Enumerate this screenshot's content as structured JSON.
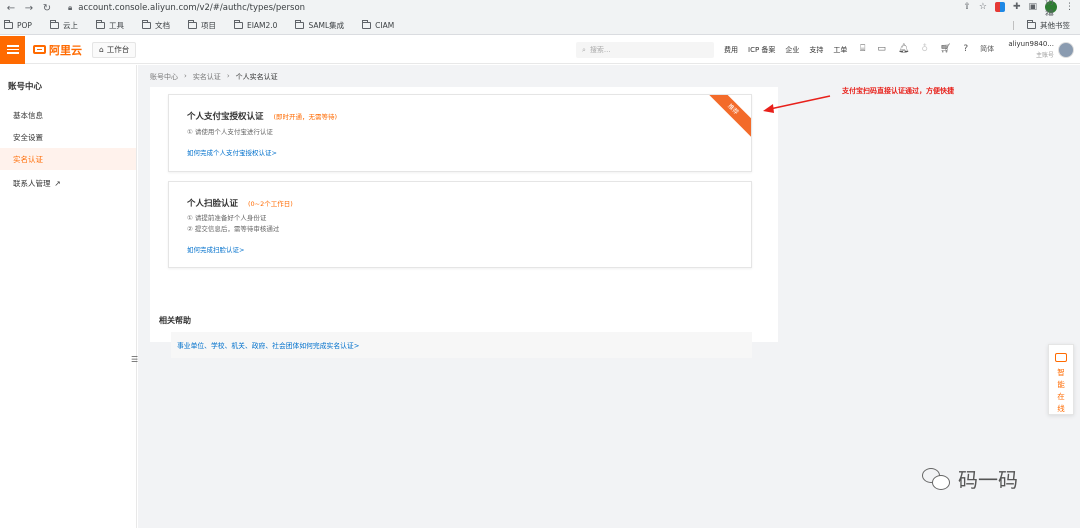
{
  "browser": {
    "url": "account.console.aliyun.com/v2/#/authc/types/person",
    "profile_badge": "仿禧",
    "bookmarks": [
      "POP",
      "云上",
      "工具",
      "文档",
      "项目",
      "EIAM2.0",
      "SAML集成",
      "CIAM"
    ],
    "other_bookmarks": "其他书签"
  },
  "header": {
    "logo_text": "阿里云",
    "workbench": "工作台",
    "search_placeholder": "搜索...",
    "menu": [
      "费用",
      "ICP 备案",
      "企业",
      "支持",
      "工单"
    ],
    "language": "简体",
    "account_name": "aliyun9840...",
    "account_role": "主账号"
  },
  "sidebar": {
    "title": "账号中心",
    "items": [
      {
        "label": "基本信息",
        "active": false
      },
      {
        "label": "安全设置",
        "active": false
      },
      {
        "label": "实名认证",
        "active": true
      },
      {
        "label": "联系人管理",
        "active": false
      }
    ]
  },
  "breadcrumb": [
    "账号中心",
    "实名认证",
    "个人实名认证"
  ],
  "cards": [
    {
      "title": "个人支付宝授权认证",
      "hint": "(即时开通，无需等待)",
      "lines": [
        "① 请使用个人支付宝进行认证"
      ],
      "link": "如何完成个人支付宝授权认证>",
      "ribbon": "推荐"
    },
    {
      "title": "个人扫脸认证",
      "hint": "(0~2个工作日)",
      "lines": [
        "① 请提前准备好个人身份证",
        "② 提交信息后，需等待审核通过"
      ],
      "link": "如何完成扫脸认证>"
    }
  ],
  "help": {
    "title": "相关帮助",
    "link": "事业单位、学校、机关、政府、社会团体如何完成实名认证>"
  },
  "annotation": "支付宝扫码直接认证通过，方便快捷",
  "float_help": [
    "智",
    "能",
    "在",
    "线"
  ],
  "watermark": "码一码",
  "colors": {
    "accent": "#ff6a00",
    "link": "#0070cc",
    "annotation": "#e8201a"
  }
}
